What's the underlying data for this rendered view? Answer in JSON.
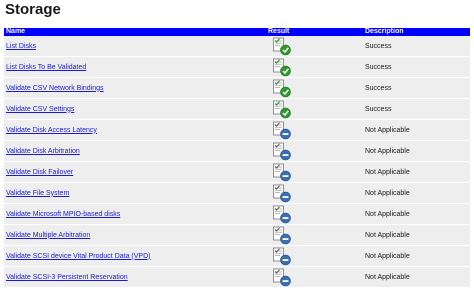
{
  "page": {
    "title": "Storage"
  },
  "table": {
    "headers": {
      "name": "Name",
      "result": "Result",
      "description": "Description"
    },
    "rows": [
      {
        "name": "List Disks",
        "result": "success-check-icon",
        "description": "Success"
      },
      {
        "name": "List Disks To Be Validated",
        "result": "success-check-icon",
        "description": "Success"
      },
      {
        "name": "Validate CSV Network Bindings",
        "result": "success-check-icon",
        "description": "Success"
      },
      {
        "name": "Validate CSV Settings",
        "result": "success-check-icon",
        "description": "Success"
      },
      {
        "name": "Validate Disk Access Latency",
        "result": "not-applicable-icon",
        "description": "Not Applicable"
      },
      {
        "name": "Validate Disk Arbitration",
        "result": "not-applicable-icon",
        "description": "Not Applicable"
      },
      {
        "name": "Validate Disk Failover",
        "result": "not-applicable-icon",
        "description": "Not Applicable"
      },
      {
        "name": "Validate File System",
        "result": "not-applicable-icon",
        "description": "Not Applicable"
      },
      {
        "name": "Validate Microsoft MPIO-based disks",
        "result": "not-applicable-icon",
        "description": "Not Applicable"
      },
      {
        "name": "Validate Multiple Arbitration",
        "result": "not-applicable-icon",
        "description": "Not Applicable"
      },
      {
        "name": "Validate SCSI device Vital Product Data (VPD)",
        "result": "not-applicable-icon",
        "description": "Not Applicable"
      },
      {
        "name": "Validate SCSI-3 Persistent Reservation",
        "result": "not-applicable-icon",
        "description": "Not Applicable"
      }
    ]
  },
  "colors": {
    "header_bg": "#0000ff",
    "row_bg": "#eeeeee",
    "link": "#1a1ad0",
    "success_badge": "#2e9a2e",
    "not_applicable_badge": "#3a6fb0"
  }
}
